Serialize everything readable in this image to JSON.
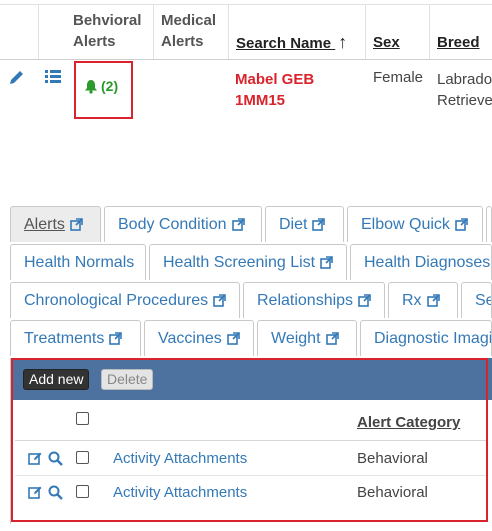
{
  "grid": {
    "headers": {
      "behavioral_alerts": [
        "Behvioral",
        "Alerts"
      ],
      "medical_alerts": [
        "Medical",
        "Alerts"
      ],
      "search_name": "Search Name",
      "sort_arrow": "↑",
      "sex": "Sex",
      "breed": "Breed"
    },
    "row": {
      "alert_count": "(2)",
      "name_line1": "Mabel GEB",
      "name_line2": "1MM15",
      "sex": "Female",
      "breed_line1": "Labrado",
      "breed_line2": "Retriever"
    }
  },
  "tabs": {
    "row1": [
      "Alerts",
      "Body Condition",
      "Diet",
      "Elbow Quick"
    ],
    "row2": [
      "Health Normals",
      "Health Screening List",
      "Health Diagnoses"
    ],
    "row3": [
      "Chronological Procedures",
      "Relationships",
      "Rx",
      "Se"
    ],
    "row4": [
      "Treatments",
      "Vaccines",
      "Weight",
      "Diagnostic Imagi"
    ]
  },
  "panel": {
    "add_label": "Add new",
    "delete_label": "Delete",
    "column_header": "Alert Category",
    "rows": [
      {
        "name": "Activity Attachments",
        "category": "Behavioral"
      },
      {
        "name": "Activity Attachments",
        "category": "Behavioral"
      }
    ]
  },
  "colors": {
    "accent_red": "#d9232d",
    "link_blue": "#3479b7",
    "bar_blue": "#4e72a0",
    "bell_green": "#2a9b2a"
  },
  "icons": [
    "edit-icon",
    "list-icon",
    "bell-icon",
    "external-link-icon",
    "search-icon",
    "checkbox"
  ]
}
